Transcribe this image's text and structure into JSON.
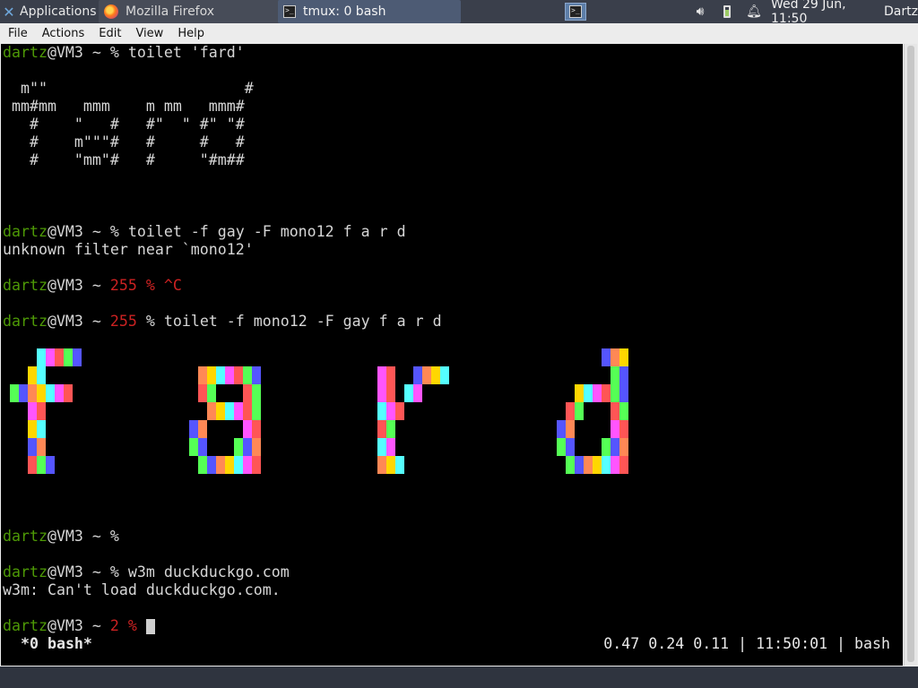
{
  "panel": {
    "applications_label": "Applications",
    "windows": [
      {
        "title": "Mozilla Firefox",
        "icon": "firefox-icon"
      },
      {
        "title": "tmux: 0 bash",
        "icon": "terminal-icon"
      }
    ],
    "clock": "Wed 29 Jun, 11:50",
    "user": "Dartz",
    "tray_icons": [
      "volume-icon",
      "battery-icon",
      "notification-bell-icon"
    ]
  },
  "menu": [
    "File",
    "Actions",
    "Edit",
    "View",
    "Help"
  ],
  "terminal": {
    "prompt_user": "dartz",
    "prompt_host": "@VM3 ~ ",
    "lines": [
      {
        "cmd": "% toilet 'fard'"
      },
      {
        "cmd": "% toilet -f gay -F mono12 f a r d",
        "out": "unknown filter near `mono12'"
      },
      {
        "status": "255",
        "cmd": "% ^C"
      },
      {
        "status": "255",
        "cmd": "% toilet -f mono12 -F gay f a r d"
      },
      {
        "cmd": "%"
      },
      {
        "cmd": "% w3m duckduckgo.com",
        "out": "w3m: Can't load duckduckgo.com."
      },
      {
        "status": "2",
        "cmd": "%"
      }
    ],
    "ascii_art": "  m\"\"                      #\n mm#mm   mmm    m mm   mmm#\n   #    \"   #   #\"  \" #\" \"#\n   #    m\"\"\"#   #     #   #\n   #    \"mm\"#   #     \"#m##",
    "rainbow_word": "f a r d"
  },
  "tmux_status": {
    "left": " *0 bash*",
    "right": "0.47 0.24 0.11 | 11:50:01 | bash"
  },
  "colors": {
    "prompt_green": "#4e9a06",
    "status_red": "#cc2222",
    "panel_bg": "#3a3f4b",
    "active_window": "#4d5b74"
  }
}
